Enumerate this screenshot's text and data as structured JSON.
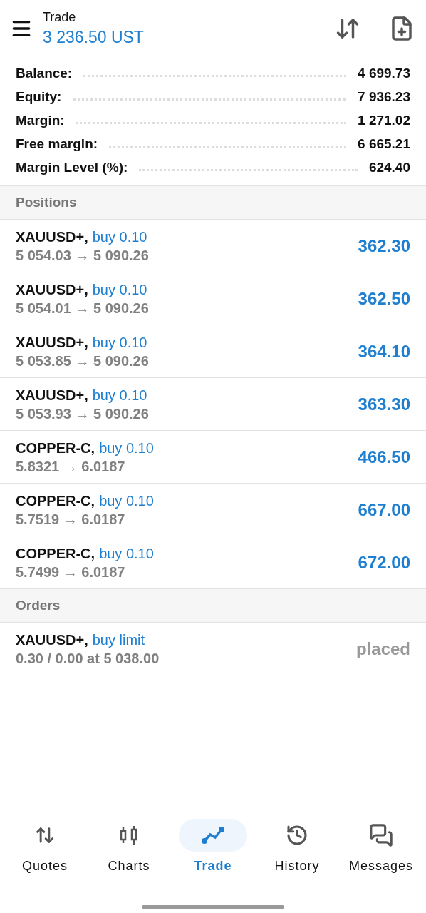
{
  "header": {
    "title": "Trade",
    "balance": "3 236.50 UST"
  },
  "summary": [
    {
      "label": "Balance:",
      "value": "4 699.73"
    },
    {
      "label": "Equity:",
      "value": "7 936.23"
    },
    {
      "label": "Margin:",
      "value": "1 271.02"
    },
    {
      "label": "Free margin:",
      "value": "6 665.21"
    },
    {
      "label": "Margin Level (%):",
      "value": "624.40"
    }
  ],
  "positions_title": "Positions",
  "positions": [
    {
      "symbol": "XAUUSD+,",
      "side": "buy 0.10",
      "prices": "5 054.03 → 5 090.26",
      "profit": "362.30"
    },
    {
      "symbol": "XAUUSD+,",
      "side": "buy 0.10",
      "prices": "5 054.01 → 5 090.26",
      "profit": "362.50"
    },
    {
      "symbol": "XAUUSD+,",
      "side": "buy 0.10",
      "prices": "5 053.85 → 5 090.26",
      "profit": "364.10"
    },
    {
      "symbol": "XAUUSD+,",
      "side": "buy 0.10",
      "prices": "5 053.93 → 5 090.26",
      "profit": "363.30"
    },
    {
      "symbol": "COPPER-C,",
      "side": "buy 0.10",
      "prices": "5.8321 → 6.0187",
      "profit": "466.50"
    },
    {
      "symbol": "COPPER-C,",
      "side": "buy 0.10",
      "prices": "5.7519 → 6.0187",
      "profit": "667.00"
    },
    {
      "symbol": "COPPER-C,",
      "side": "buy 0.10",
      "prices": "5.7499 → 6.0187",
      "profit": "672.00"
    }
  ],
  "orders_title": "Orders",
  "orders": [
    {
      "symbol": "XAUUSD+,",
      "side": "buy limit",
      "prices": "0.30 / 0.00 at 5 038.00",
      "status": "placed"
    }
  ],
  "nav": [
    {
      "label": "Quotes",
      "selected": false
    },
    {
      "label": "Charts",
      "selected": false
    },
    {
      "label": "Trade",
      "selected": true
    },
    {
      "label": "History",
      "selected": false
    },
    {
      "label": "Messages",
      "selected": false
    }
  ]
}
